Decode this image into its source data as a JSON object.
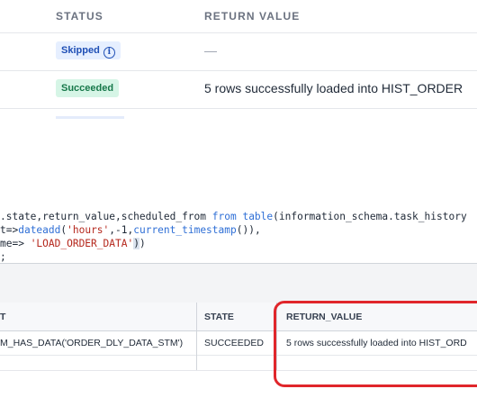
{
  "task_history": {
    "columns": {
      "status": "STATUS",
      "return_value": "RETURN VALUE"
    },
    "rows": [
      {
        "status": "Skipped",
        "status_icon": "info-icon",
        "return_value": "—"
      },
      {
        "status": "Succeeded",
        "return_value": "5 rows successfully loaded into HIST_ORDER"
      }
    ]
  },
  "code_editor": {
    "lines": [
      [
        {
          "t": ".state,return_value,scheduled_from ",
          "c": "def"
        },
        {
          "t": "from",
          "c": "kw"
        },
        {
          "t": " ",
          "c": "def"
        },
        {
          "t": "table",
          "c": "kw"
        },
        {
          "t": "(information_schema.task_history",
          "c": "def"
        }
      ],
      [
        {
          "t": "t=>",
          "c": "def"
        },
        {
          "t": "dateadd",
          "c": "kw"
        },
        {
          "t": "(",
          "c": "def"
        },
        {
          "t": "'hours'",
          "c": "str"
        },
        {
          "t": ",-1,",
          "c": "def"
        },
        {
          "t": "current_timestamp",
          "c": "kw"
        },
        {
          "t": "()),",
          "c": "def"
        }
      ],
      [
        {
          "t": "me=> ",
          "c": "def"
        },
        {
          "t": "'LOAD_ORDER_DATA'",
          "c": "str"
        },
        {
          "t": ")",
          "c": "cursor"
        },
        {
          "t": ")",
          "c": "def"
        }
      ],
      [
        {
          "t": ";",
          "c": "def"
        }
      ]
    ]
  },
  "result_grid": {
    "columns": [
      "T",
      "STATE",
      "RETURN_VALUE"
    ],
    "rows": [
      [
        "M_HAS_DATA('ORDER_DLY_DATA_STM')",
        "SUCCEEDED",
        "5 rows successfully loaded into HIST_ORD"
      ]
    ]
  },
  "colors": {
    "highlight": "#e0262b",
    "keyword": "#2f6fd6",
    "string": "#b5271c",
    "skipped_badge_bg": "#e6efff",
    "succeeded_badge_bg": "#d6f5e6"
  }
}
